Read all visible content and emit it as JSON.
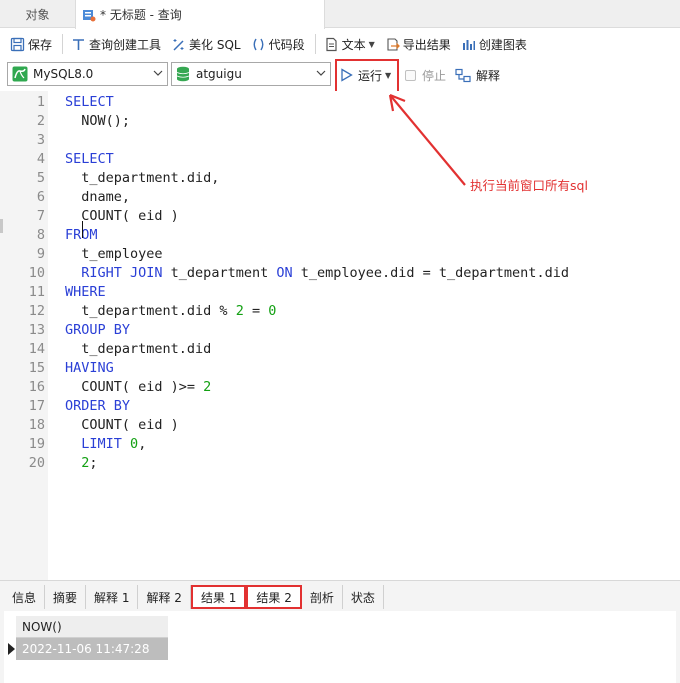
{
  "tabs": {
    "objects": "对象",
    "query": "* 无标题 - 查询"
  },
  "toolbar": {
    "save": "保存",
    "query_builder": "查询创建工具",
    "beautify": "美化 SQL",
    "snippet": "代码段",
    "text": "文本",
    "export": "导出结果",
    "chart": "创建图表"
  },
  "connection": {
    "selected": "MySQL8.0"
  },
  "database": {
    "selected": "atguigu"
  },
  "actions": {
    "run": "运行",
    "stop": "停止",
    "explain": "解释"
  },
  "editor": {
    "line_numbers": [
      "1",
      "2",
      "3",
      "4",
      "5",
      "6",
      "7",
      "8",
      "9",
      "10",
      "11",
      "12",
      "13",
      "14",
      "15",
      "16",
      "17",
      "18",
      "19",
      "20"
    ],
    "lines": [
      [
        {
          "t": "SELECT",
          "c": "kw"
        }
      ],
      [
        {
          "t": "  NOW();",
          "c": ""
        }
      ],
      [
        {
          "t": "",
          "c": ""
        }
      ],
      [
        {
          "t": "SELECT",
          "c": "kw"
        }
      ],
      [
        {
          "t": "  t_department.did,",
          "c": ""
        }
      ],
      [
        {
          "t": "  dname,",
          "c": ""
        }
      ],
      [
        {
          "t": "  COUNT( eid )",
          "c": ""
        }
      ],
      [
        {
          "t": "FROM",
          "c": "kw"
        }
      ],
      [
        {
          "t": "  t_employee",
          "c": ""
        }
      ],
      [
        {
          "t": "  ",
          "c": ""
        },
        {
          "t": "RIGHT JOIN",
          "c": "kw"
        },
        {
          "t": " t_department ",
          "c": ""
        },
        {
          "t": "ON",
          "c": "kw"
        },
        {
          "t": " t_employee.did = t_department.did",
          "c": ""
        }
      ],
      [
        {
          "t": "WHERE",
          "c": "kw"
        }
      ],
      [
        {
          "t": "  t_department.did % ",
          "c": ""
        },
        {
          "t": "2",
          "c": "num"
        },
        {
          "t": " = ",
          "c": ""
        },
        {
          "t": "0",
          "c": "num"
        }
      ],
      [
        {
          "t": "GROUP BY",
          "c": "kw"
        }
      ],
      [
        {
          "t": "  t_department.did",
          "c": ""
        }
      ],
      [
        {
          "t": "HAVING",
          "c": "kw"
        }
      ],
      [
        {
          "t": "  COUNT( eid )>= ",
          "c": ""
        },
        {
          "t": "2",
          "c": "num"
        }
      ],
      [
        {
          "t": "ORDER BY",
          "c": "kw"
        }
      ],
      [
        {
          "t": "  COUNT( eid )",
          "c": ""
        }
      ],
      [
        {
          "t": "  ",
          "c": ""
        },
        {
          "t": "LIMIT",
          "c": "kw"
        },
        {
          "t": " ",
          "c": ""
        },
        {
          "t": "0",
          "c": "num"
        },
        {
          "t": ",",
          "c": ""
        }
      ],
      [
        {
          "t": "  ",
          "c": ""
        },
        {
          "t": "2",
          "c": "num"
        },
        {
          "t": ";",
          "c": ""
        }
      ]
    ]
  },
  "annotation": {
    "text": "执行当前窗口所有sql"
  },
  "result_tabs": [
    "信息",
    "摘要",
    "解释 1",
    "解释 2",
    "结果 1",
    "结果 2",
    "剖析",
    "状态"
  ],
  "result": {
    "column": "NOW()",
    "value": "2022-11-06 11:47:28"
  },
  "colors": {
    "keyword": "#2a3fd6",
    "number": "#13a013",
    "highlight": "#e23131"
  }
}
